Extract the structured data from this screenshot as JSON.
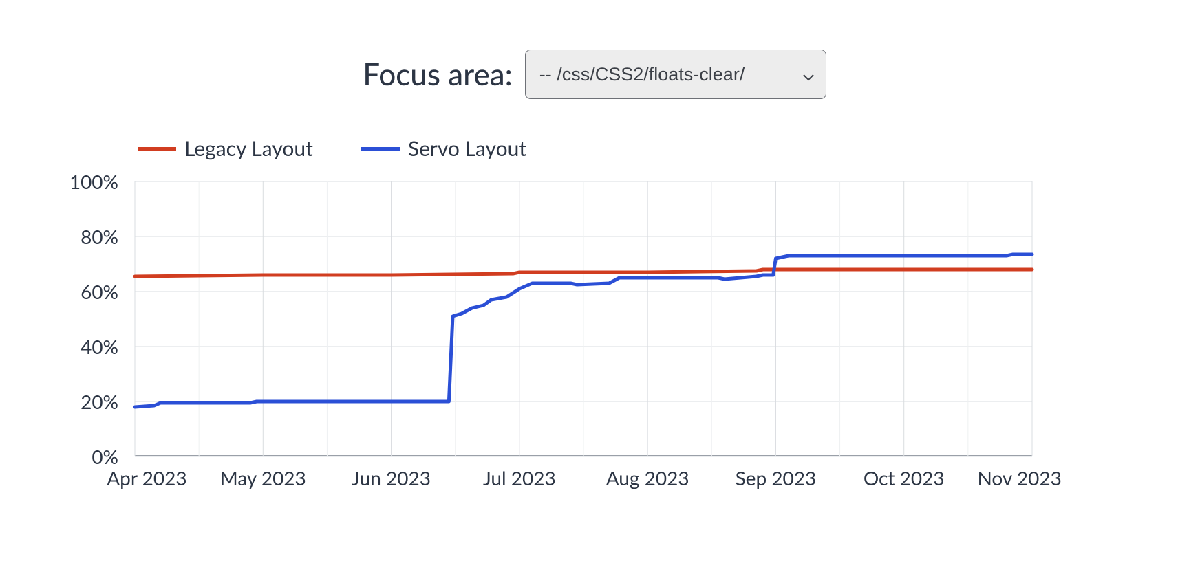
{
  "header": {
    "label": "Focus area:",
    "select_value": "-- /css/CSS2/floats-clear/"
  },
  "legend": [
    {
      "name": "Legacy Layout",
      "color": "#d13d20"
    },
    {
      "name": "Servo Layout",
      "color": "#2b4fd6"
    }
  ],
  "y_ticks": [
    0,
    20,
    40,
    60,
    80,
    100
  ],
  "y_suffix": "%",
  "x_ticks": [
    "Apr 2023",
    "May 2023",
    "Jun 2023",
    "Jul 2023",
    "Aug 2023",
    "Sep 2023",
    "Oct 2023",
    "Nov 2023"
  ],
  "chart_data": {
    "type": "line",
    "xlabel": "",
    "ylabel": "",
    "ylim": [
      0,
      100
    ],
    "x_categories": [
      "Apr 2023",
      "May 2023",
      "Jun 2023",
      "Jul 2023",
      "Aug 2023",
      "Sep 2023",
      "Oct 2023",
      "Nov 2023"
    ],
    "series": [
      {
        "name": "Legacy Layout",
        "color": "#d13d20",
        "points": [
          {
            "x": 0.0,
            "y": 65.5
          },
          {
            "x": 1.0,
            "y": 66.0
          },
          {
            "x": 2.0,
            "y": 66.0
          },
          {
            "x": 2.95,
            "y": 66.5
          },
          {
            "x": 3.0,
            "y": 67.0
          },
          {
            "x": 4.0,
            "y": 67.0
          },
          {
            "x": 4.85,
            "y": 67.5
          },
          {
            "x": 4.9,
            "y": 68.0
          },
          {
            "x": 5.0,
            "y": 68.0
          },
          {
            "x": 6.0,
            "y": 68.0
          },
          {
            "x": 7.0,
            "y": 68.0
          }
        ]
      },
      {
        "name": "Servo Layout",
        "color": "#2b4fd6",
        "points": [
          {
            "x": 0.0,
            "y": 18.0
          },
          {
            "x": 0.15,
            "y": 18.5
          },
          {
            "x": 0.2,
            "y": 19.5
          },
          {
            "x": 0.9,
            "y": 19.5
          },
          {
            "x": 0.95,
            "y": 20.0
          },
          {
            "x": 2.0,
            "y": 20.0
          },
          {
            "x": 2.45,
            "y": 20.0
          },
          {
            "x": 2.48,
            "y": 51.0
          },
          {
            "x": 2.55,
            "y": 52.0
          },
          {
            "x": 2.63,
            "y": 54.0
          },
          {
            "x": 2.72,
            "y": 55.0
          },
          {
            "x": 2.78,
            "y": 57.0
          },
          {
            "x": 2.9,
            "y": 58.0
          },
          {
            "x": 3.0,
            "y": 61.0
          },
          {
            "x": 3.1,
            "y": 63.0
          },
          {
            "x": 3.4,
            "y": 63.0
          },
          {
            "x": 3.45,
            "y": 62.5
          },
          {
            "x": 3.7,
            "y": 63.0
          },
          {
            "x": 3.78,
            "y": 65.0
          },
          {
            "x": 4.0,
            "y": 65.0
          },
          {
            "x": 4.55,
            "y": 65.0
          },
          {
            "x": 4.6,
            "y": 64.5
          },
          {
            "x": 4.85,
            "y": 65.5
          },
          {
            "x": 4.9,
            "y": 66.0
          },
          {
            "x": 4.98,
            "y": 66.0
          },
          {
            "x": 5.0,
            "y": 72.0
          },
          {
            "x": 5.1,
            "y": 73.0
          },
          {
            "x": 6.0,
            "y": 73.0
          },
          {
            "x": 6.8,
            "y": 73.0
          },
          {
            "x": 6.85,
            "y": 73.5
          },
          {
            "x": 7.0,
            "y": 73.5
          }
        ]
      }
    ]
  }
}
